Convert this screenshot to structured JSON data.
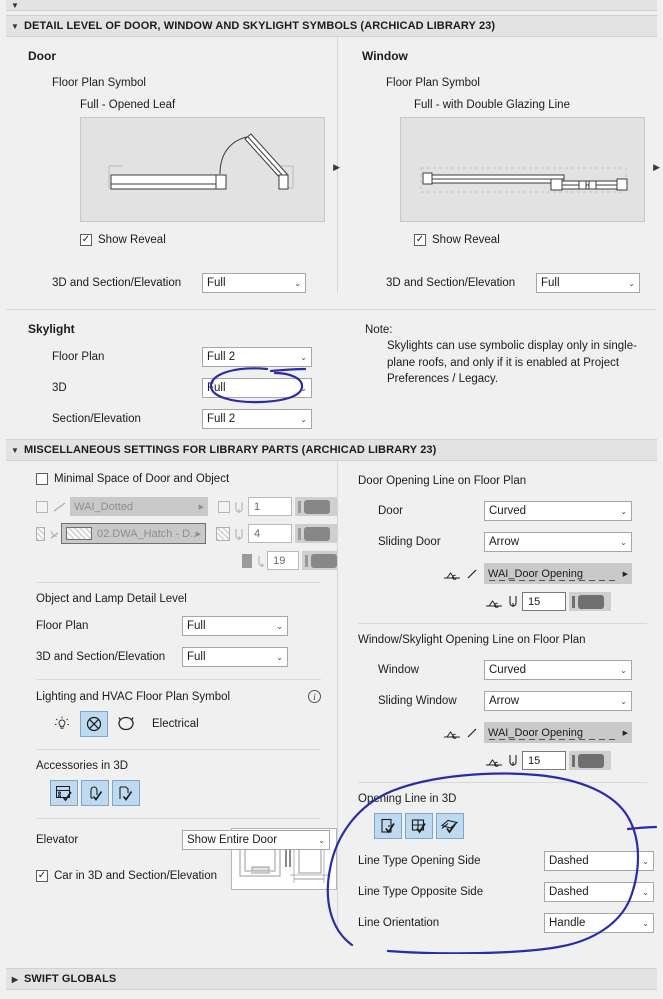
{
  "sections": {
    "clipped_top": "",
    "detail_level": {
      "title": "DETAIL LEVEL OF DOOR, WINDOW AND SKYLIGHT SYMBOLS (ARCHICAD LIBRARY 23)",
      "expanded_marker": "▼"
    },
    "misc": {
      "title": "MISCELLANEOUS SETTINGS FOR LIBRARY PARTS (ARCHICAD LIBRARY 23)",
      "expanded_marker": "▼"
    },
    "swift": {
      "title": "SWIFT GLOBALS",
      "collapsed_marker": "▶"
    }
  },
  "door": {
    "group_title": "Door",
    "floor_plan_symbol_label": "Floor Plan Symbol",
    "symbol_name": "Full - Opened Leaf",
    "show_reveal_label": "Show Reveal",
    "show_reveal_checked": "✓",
    "detail_3d_label": "3D and Section/Elevation",
    "detail_3d_value": "Full"
  },
  "window": {
    "group_title": "Window",
    "floor_plan_symbol_label": "Floor Plan Symbol",
    "symbol_name": "Full - with Double Glazing Line",
    "show_reveal_label": "Show Reveal",
    "show_reveal_checked": "✓",
    "detail_3d_label": "3D and Section/Elevation",
    "detail_3d_value": "Full"
  },
  "skylight": {
    "group_title": "Skylight",
    "rows": [
      {
        "label": "Floor Plan",
        "value": "Full 2"
      },
      {
        "label": "3D",
        "value": "Full"
      },
      {
        "label": "Section/Elevation",
        "value": "Full 2"
      }
    ],
    "note_title": "Note:",
    "note_body": "Skylights can use symbolic display only in single-plane roofs, and only if it is enabled at Project Preferences / Legacy."
  },
  "misc_left": {
    "minimal_space_label": "Minimal Space of Door and Object",
    "minimal_space_checked": false,
    "line_row": {
      "checked": false,
      "value": "WAI_Dotted",
      "pen": "1"
    },
    "hatch_row": {
      "value": "02.DWA_Hatch - D...",
      "pen": "4"
    },
    "fill_row": {
      "pen": "19"
    },
    "object_lamp_title": "Object and Lamp Detail Level",
    "object_rows": [
      {
        "label": "Floor Plan",
        "value": "Full"
      },
      {
        "label": "3D and Section/Elevation",
        "value": "Full"
      }
    ],
    "lighting_title": "Lighting and HVAC Floor Plan Symbol",
    "lighting_info_icon": "info-icon",
    "lighting_label": "Electrical",
    "accessories_title": "Accessories in 3D",
    "elevator_label": "Elevator",
    "elevator_value": "Show Entire Door",
    "car_label": "Car in 3D and Section/Elevation",
    "car_checked": "✓"
  },
  "misc_right": {
    "door_opening_title": "Door Opening Line on Floor Plan",
    "door_rows": [
      {
        "label": "Door",
        "value": "Curved"
      },
      {
        "label": "Sliding Door",
        "value": "Arrow"
      }
    ],
    "door_linetype": "WAI_Door Opening",
    "door_pen": "15",
    "window_opening_title": "Window/Skylight Opening Line on Floor Plan",
    "window_rows": [
      {
        "label": "Window",
        "value": "Curved"
      },
      {
        "label": "Sliding Window",
        "value": "Arrow"
      }
    ],
    "window_linetype": "WAI_Door Opening",
    "window_pen": "15",
    "opening3d_title": "Opening Line in 3D",
    "opening3d_rows": [
      {
        "label": "Line Type Opening Side",
        "value": "Dashed"
      },
      {
        "label": "Line Type Opposite Side",
        "value": "Dashed"
      },
      {
        "label": "Line Orientation",
        "value": "Handle"
      }
    ]
  },
  "colors": {
    "background": "#f0f0f0",
    "section_header": "#e3e3e3",
    "toggle_selected": "#bed9f0",
    "annotation_ink": "#2b2ba8",
    "preview_bg": "#e2e2e2"
  }
}
